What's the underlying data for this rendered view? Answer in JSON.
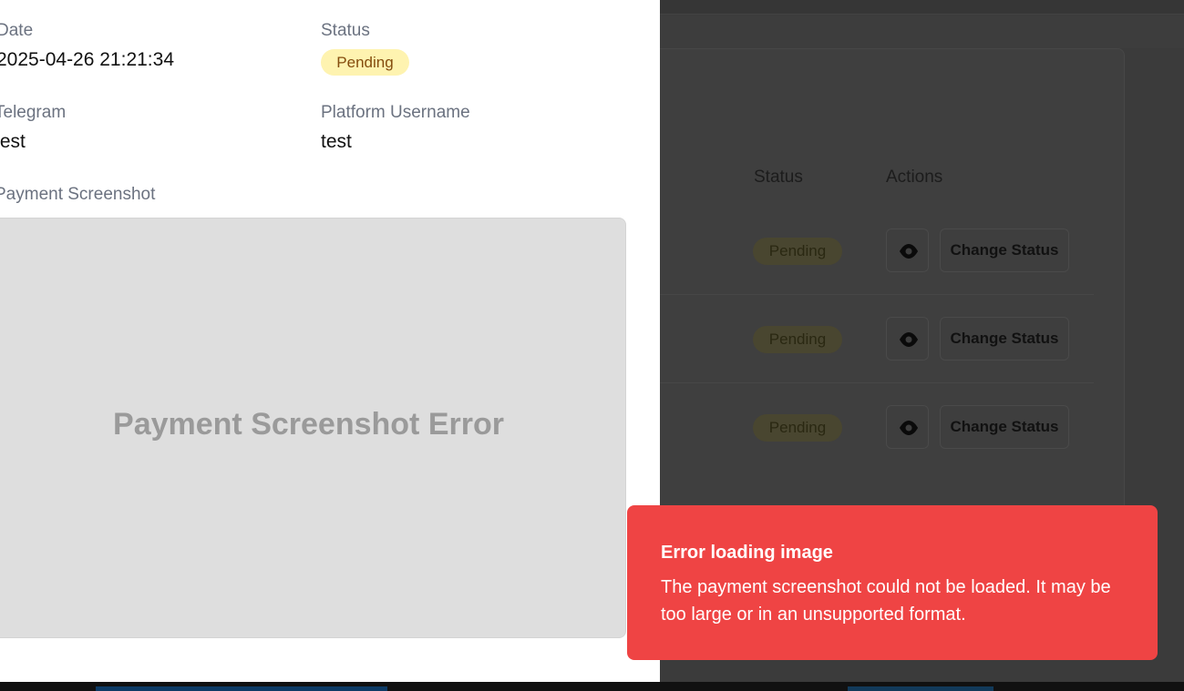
{
  "background": {
    "table_headers": {
      "status": "Status",
      "actions": "Actions"
    },
    "rows": [
      {
        "status": "Pending",
        "action_label": "Change Status"
      },
      {
        "status": "Pending",
        "action_label": "Change Status"
      },
      {
        "status": "Pending",
        "action_label": "Change Status"
      }
    ]
  },
  "modal": {
    "date_label": "Date",
    "date_value": "2025-04-26 21:21:34",
    "status_label": "Status",
    "status_value": "Pending",
    "telegram_label": "Telegram",
    "telegram_value": "test",
    "platform_username_label": "Platform Username",
    "platform_username_value": "test",
    "payment_screenshot_label": "Payment Screenshot",
    "screenshot_placeholder": "Payment Screenshot Error"
  },
  "toast": {
    "title": "Error loading image",
    "message": "The payment screenshot could not be loaded. It may be too large or in an unsupported format."
  },
  "colors": {
    "toast_bg": "#ef4444",
    "pending_bg": "#fef3b0",
    "pending_text": "#854d0e"
  }
}
